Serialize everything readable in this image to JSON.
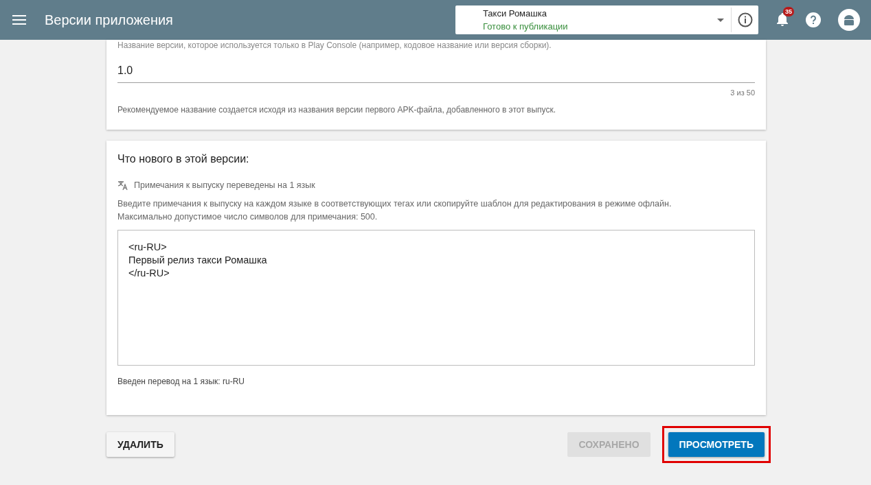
{
  "header": {
    "title": "Версии приложения",
    "app": {
      "name": "Такси Ромашка",
      "status": "Готово к публикации"
    },
    "notifications": {
      "count": "35"
    }
  },
  "version_card": {
    "hint": "Название версии, которое используется только в Play Console (например, кодовое название или версия сборки).",
    "value": "1.0",
    "counter": "3 из 50",
    "help": "Рекомендуемое название создается исходя из названия версии первого APK-файла, добавленного в этот выпуск."
  },
  "notes_card": {
    "title": "Что нового в этой версии:",
    "translated": "Примечания к выпуску переведены на 1 язык",
    "instructions": [
      "Введите примечания к выпуску на каждом языке в соответствующих тегах или скопируйте шаблон для редактирования в режиме офлайн.",
      "Максимально допустимое число символов для примечания: 500."
    ],
    "value": "<ru-RU>\nПервый релиз такси Ромашка\n</ru-RU>",
    "footer": "Введен перевод на 1 язык: ru-RU"
  },
  "buttons": [
    {
      "label": "УДАЛИТЬ",
      "kind": "raised",
      "disabled": false,
      "highlighted": false
    },
    {
      "label": "СОХРАНЕНО",
      "kind": "flat",
      "disabled": true,
      "highlighted": false
    },
    {
      "label": "ПРОСМОТРЕТЬ",
      "kind": "primary",
      "disabled": false,
      "highlighted": true
    }
  ]
}
